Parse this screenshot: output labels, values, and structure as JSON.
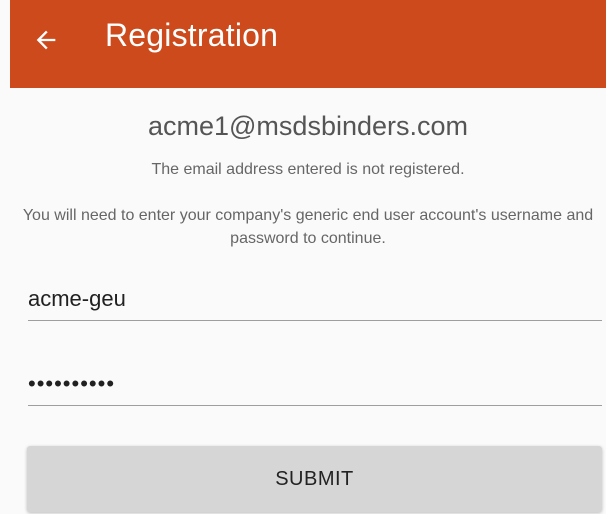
{
  "appbar": {
    "title": "Registration",
    "back_icon": "arrow-left-icon",
    "color": "#cc4a1b"
  },
  "message": {
    "email": "acme1@msdsbinders.com",
    "status": "The email address entered is not registered.",
    "instructions": "You will need to enter your company's generic end user account's username and password to continue."
  },
  "form": {
    "username_value": "acme-geu",
    "password_value": "••••••••••",
    "submit_label": "SUBMIT"
  }
}
